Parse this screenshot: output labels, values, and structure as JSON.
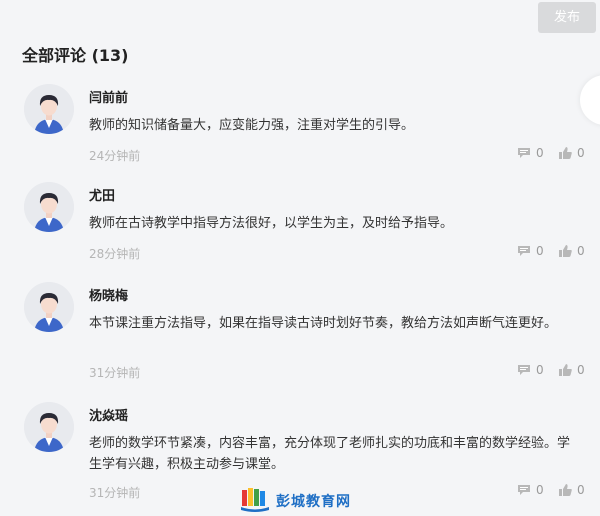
{
  "toolbar": {
    "publish_label": "发布"
  },
  "comments_header": {
    "title": "全部评论 (13)"
  },
  "comments": [
    {
      "name": "闫前前",
      "text": "教师的知识储备量大，应变能力强，注重对学生的引导。",
      "time": "24分钟前",
      "reply_count": "0",
      "like_count": "0"
    },
    {
      "name": "尤田",
      "text": "教师在古诗教学中指导方法很好，以学生为主，及时给予指导。",
      "time": "28分钟前",
      "reply_count": "0",
      "like_count": "0"
    },
    {
      "name": "杨晓梅",
      "text": "本节课注重方法指导，如果在指导读古诗时划好节奏，教给方法如声断气连更好。",
      "time": "31分钟前",
      "reply_count": "0",
      "like_count": "0"
    },
    {
      "name": "沈焱瑶",
      "text": "老师的数学环节紧凑，内容丰富，充分体现了老师扎实的功底和丰富的数学经验。学生学有兴趣，积极主动参与课堂。",
      "time": "31分钟前",
      "reply_count": "0",
      "like_count": "0"
    }
  ],
  "watermark": {
    "text": "彭城教育网"
  },
  "colors": {
    "accent": "#1f6fc5",
    "button_bg": "#d9dadc",
    "page_bg": "#f4f5f7"
  },
  "icons": {
    "reply": "comment-icon",
    "like": "thumbs-up-icon",
    "avatar": "user-avatar-icon"
  }
}
